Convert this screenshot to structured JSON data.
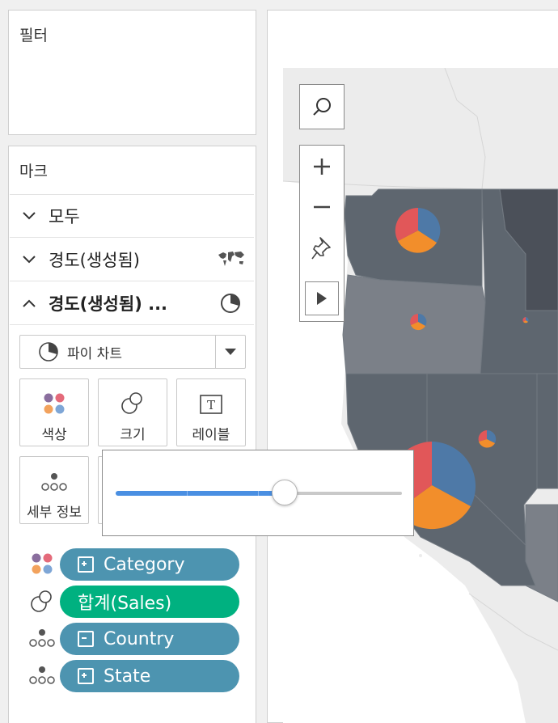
{
  "filters": {
    "title": "필터"
  },
  "marks": {
    "title": "마크",
    "rows": [
      {
        "label": "모두",
        "state": "collapsed"
      },
      {
        "label": "경도(생성됨)",
        "state": "collapsed",
        "icon": "world-map-icon"
      },
      {
        "label": "경도(생성됨) ...",
        "state": "expanded",
        "icon": "pie-chart-icon"
      }
    ],
    "mark_type": "파이 차트",
    "tiles": {
      "color": "색상",
      "size": "크기",
      "label": "레이블",
      "detail": "세부 정보"
    },
    "pills": [
      {
        "icon": "color-dots-icon",
        "text": "Category",
        "box": "plus",
        "color": "#4d94b0"
      },
      {
        "icon": "size-circles-icon",
        "text": "합계(Sales)",
        "box": "",
        "color": "#00b180"
      },
      {
        "icon": "detail-dots-icon",
        "text": "Country",
        "box": "minus",
        "color": "#4d94b0"
      },
      {
        "icon": "detail-dots-icon",
        "text": "State",
        "box": "plus",
        "color": "#4d94b0"
      }
    ]
  },
  "size_slider": {
    "value": 0.59,
    "accent": "#4a8fe2"
  },
  "map": {
    "colors": {
      "ocean": "#ffffff",
      "land_light": "#e8e8e8",
      "state_dark": "#5e666f",
      "state_mid": "#7b8088",
      "state_darkest": "#4b5059"
    },
    "pie_colors": {
      "blue": "#4e79a7",
      "orange": "#f28e2b",
      "red": "#e15759"
    }
  }
}
